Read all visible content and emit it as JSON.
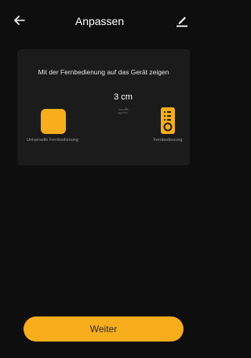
{
  "colors": {
    "background": "#0e0e0e",
    "card": "#1b1b1b",
    "accent": "#f8ad1c",
    "muted_text": "#9a9a9a"
  },
  "header": {
    "title": "Anpassen",
    "back_icon": "arrow-left-icon",
    "edit_icon": "pencil-icon"
  },
  "card": {
    "instruction": "Mit der Fernbedienung auf das Gerät zeigen",
    "distance": "3 cm",
    "left_device_label": "Universelle Fernbedienung",
    "right_device_label": "Fernbedienung",
    "arrows_icon": "swap-arrows-icon",
    "remote_icon": "remote-control-icon"
  },
  "footer": {
    "next_label": "Weiter"
  }
}
